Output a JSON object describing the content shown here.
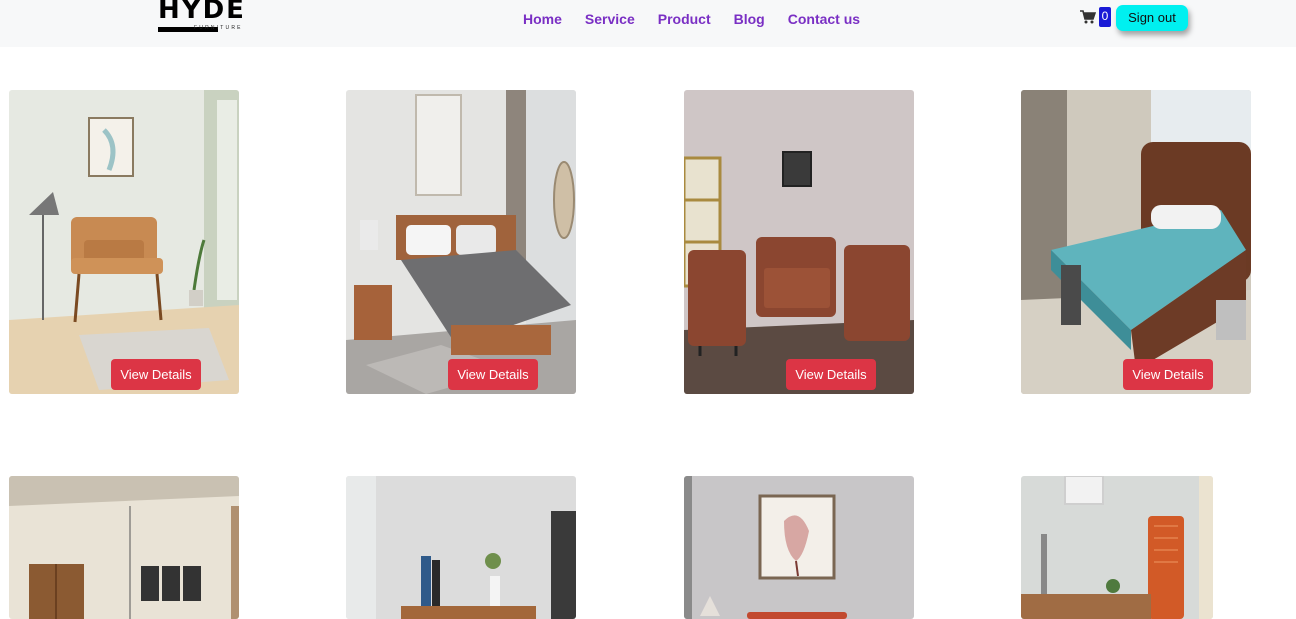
{
  "brand": {
    "name": "HYDE",
    "tagline": "FURNITURE"
  },
  "nav": {
    "links": [
      "Home",
      "Service",
      "Product",
      "Blog",
      "Contact us"
    ],
    "cart_count": "0",
    "signout_label": "Sign out"
  },
  "products": [
    {
      "image": "armchair-room",
      "button": "View Details"
    },
    {
      "image": "wooden-bed-room",
      "button": "View Details"
    },
    {
      "image": "brown-sofa-set",
      "button": "View Details"
    },
    {
      "image": "bed-with-mattress",
      "button": "View Details"
    },
    {
      "image": "wardrobe-room"
    },
    {
      "image": "desk-with-shelf"
    },
    {
      "image": "sofa-with-flower-frame"
    },
    {
      "image": "office-chair-desk"
    }
  ],
  "colors": {
    "accent": "#7a2fc4",
    "button": "#dc3545",
    "signout": "#00f0f0",
    "badge": "#1a1ad6"
  }
}
